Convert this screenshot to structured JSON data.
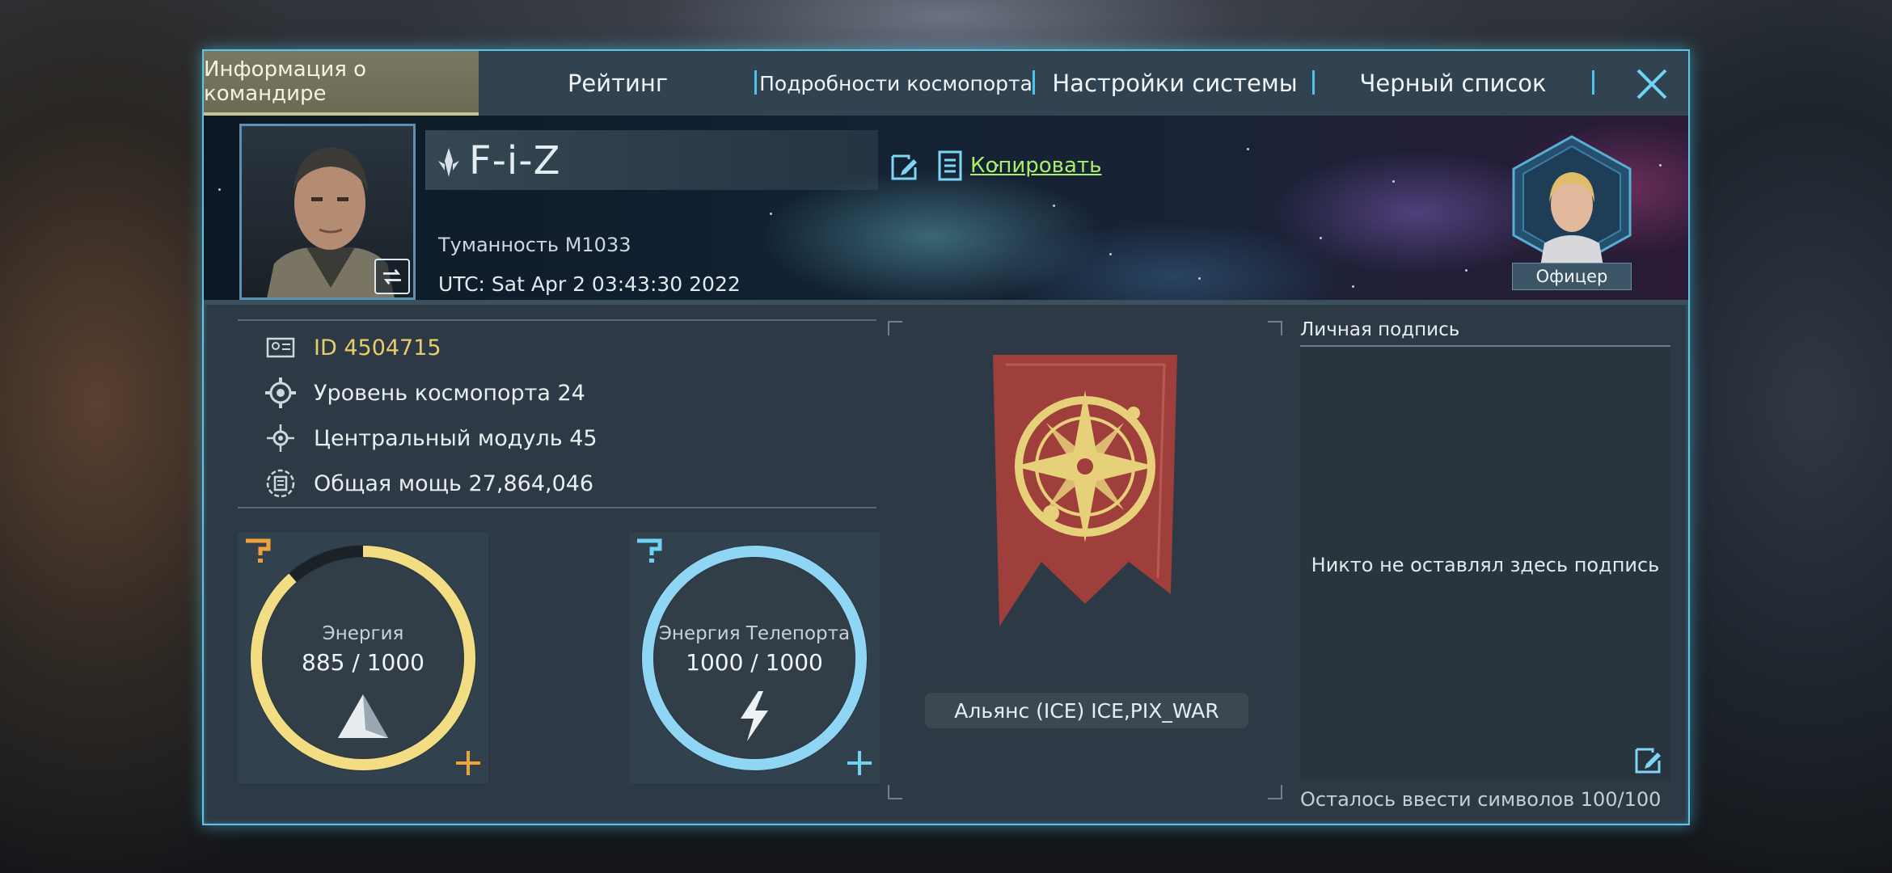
{
  "tabs": [
    {
      "label": "Информация о командире",
      "active": true
    },
    {
      "label": "Рейтинг",
      "active": false
    },
    {
      "label": "Подробности космопорта",
      "active": false
    },
    {
      "label": "Настройки системы",
      "active": false
    },
    {
      "label": "Черный список",
      "active": false
    }
  ],
  "header": {
    "commander_name": "F-i-Z",
    "copy_label": "Копировать",
    "nebula": "Туманность M1033",
    "utc": "UTC: Sat Apr  2 03:43:30 2022",
    "officer_label": "Офицер"
  },
  "stats": {
    "id": "ID 4504715",
    "spaceport_level": "Уровень космопорта 24",
    "central_module": "Центральный модуль 45",
    "total_power": "Общая мощь 27,864,046"
  },
  "energy": {
    "label": "Энергия",
    "value": "885 / 1000",
    "fraction": 0.885
  },
  "teleport_energy": {
    "label": "Энергия Телепорта",
    "value": "1000 / 1000",
    "fraction": 1.0
  },
  "alliance": {
    "name": "Альянс (ICE) ICE,PIX_WAR"
  },
  "signature": {
    "title": "Личная подпись",
    "empty_text": "Никто не оставлял здесь подпись",
    "remaining": "Осталось ввести символов 100/100"
  },
  "colors": {
    "accent": "#5cc5e6",
    "energy": "#f2dd82",
    "teleport": "#8ed6f3",
    "copy_link": "#a8f06a",
    "id_text": "#e8cd6f",
    "banner": "#9e3f3c"
  },
  "icons": [
    "close-icon",
    "swap-icon",
    "rank-icon",
    "edit-icon",
    "copy-icon",
    "id-card-icon",
    "spaceport-icon",
    "module-icon",
    "power-icon",
    "help-icon",
    "plus-icon",
    "pyramid-icon",
    "lightning-icon",
    "alliance-emblem-icon"
  ]
}
